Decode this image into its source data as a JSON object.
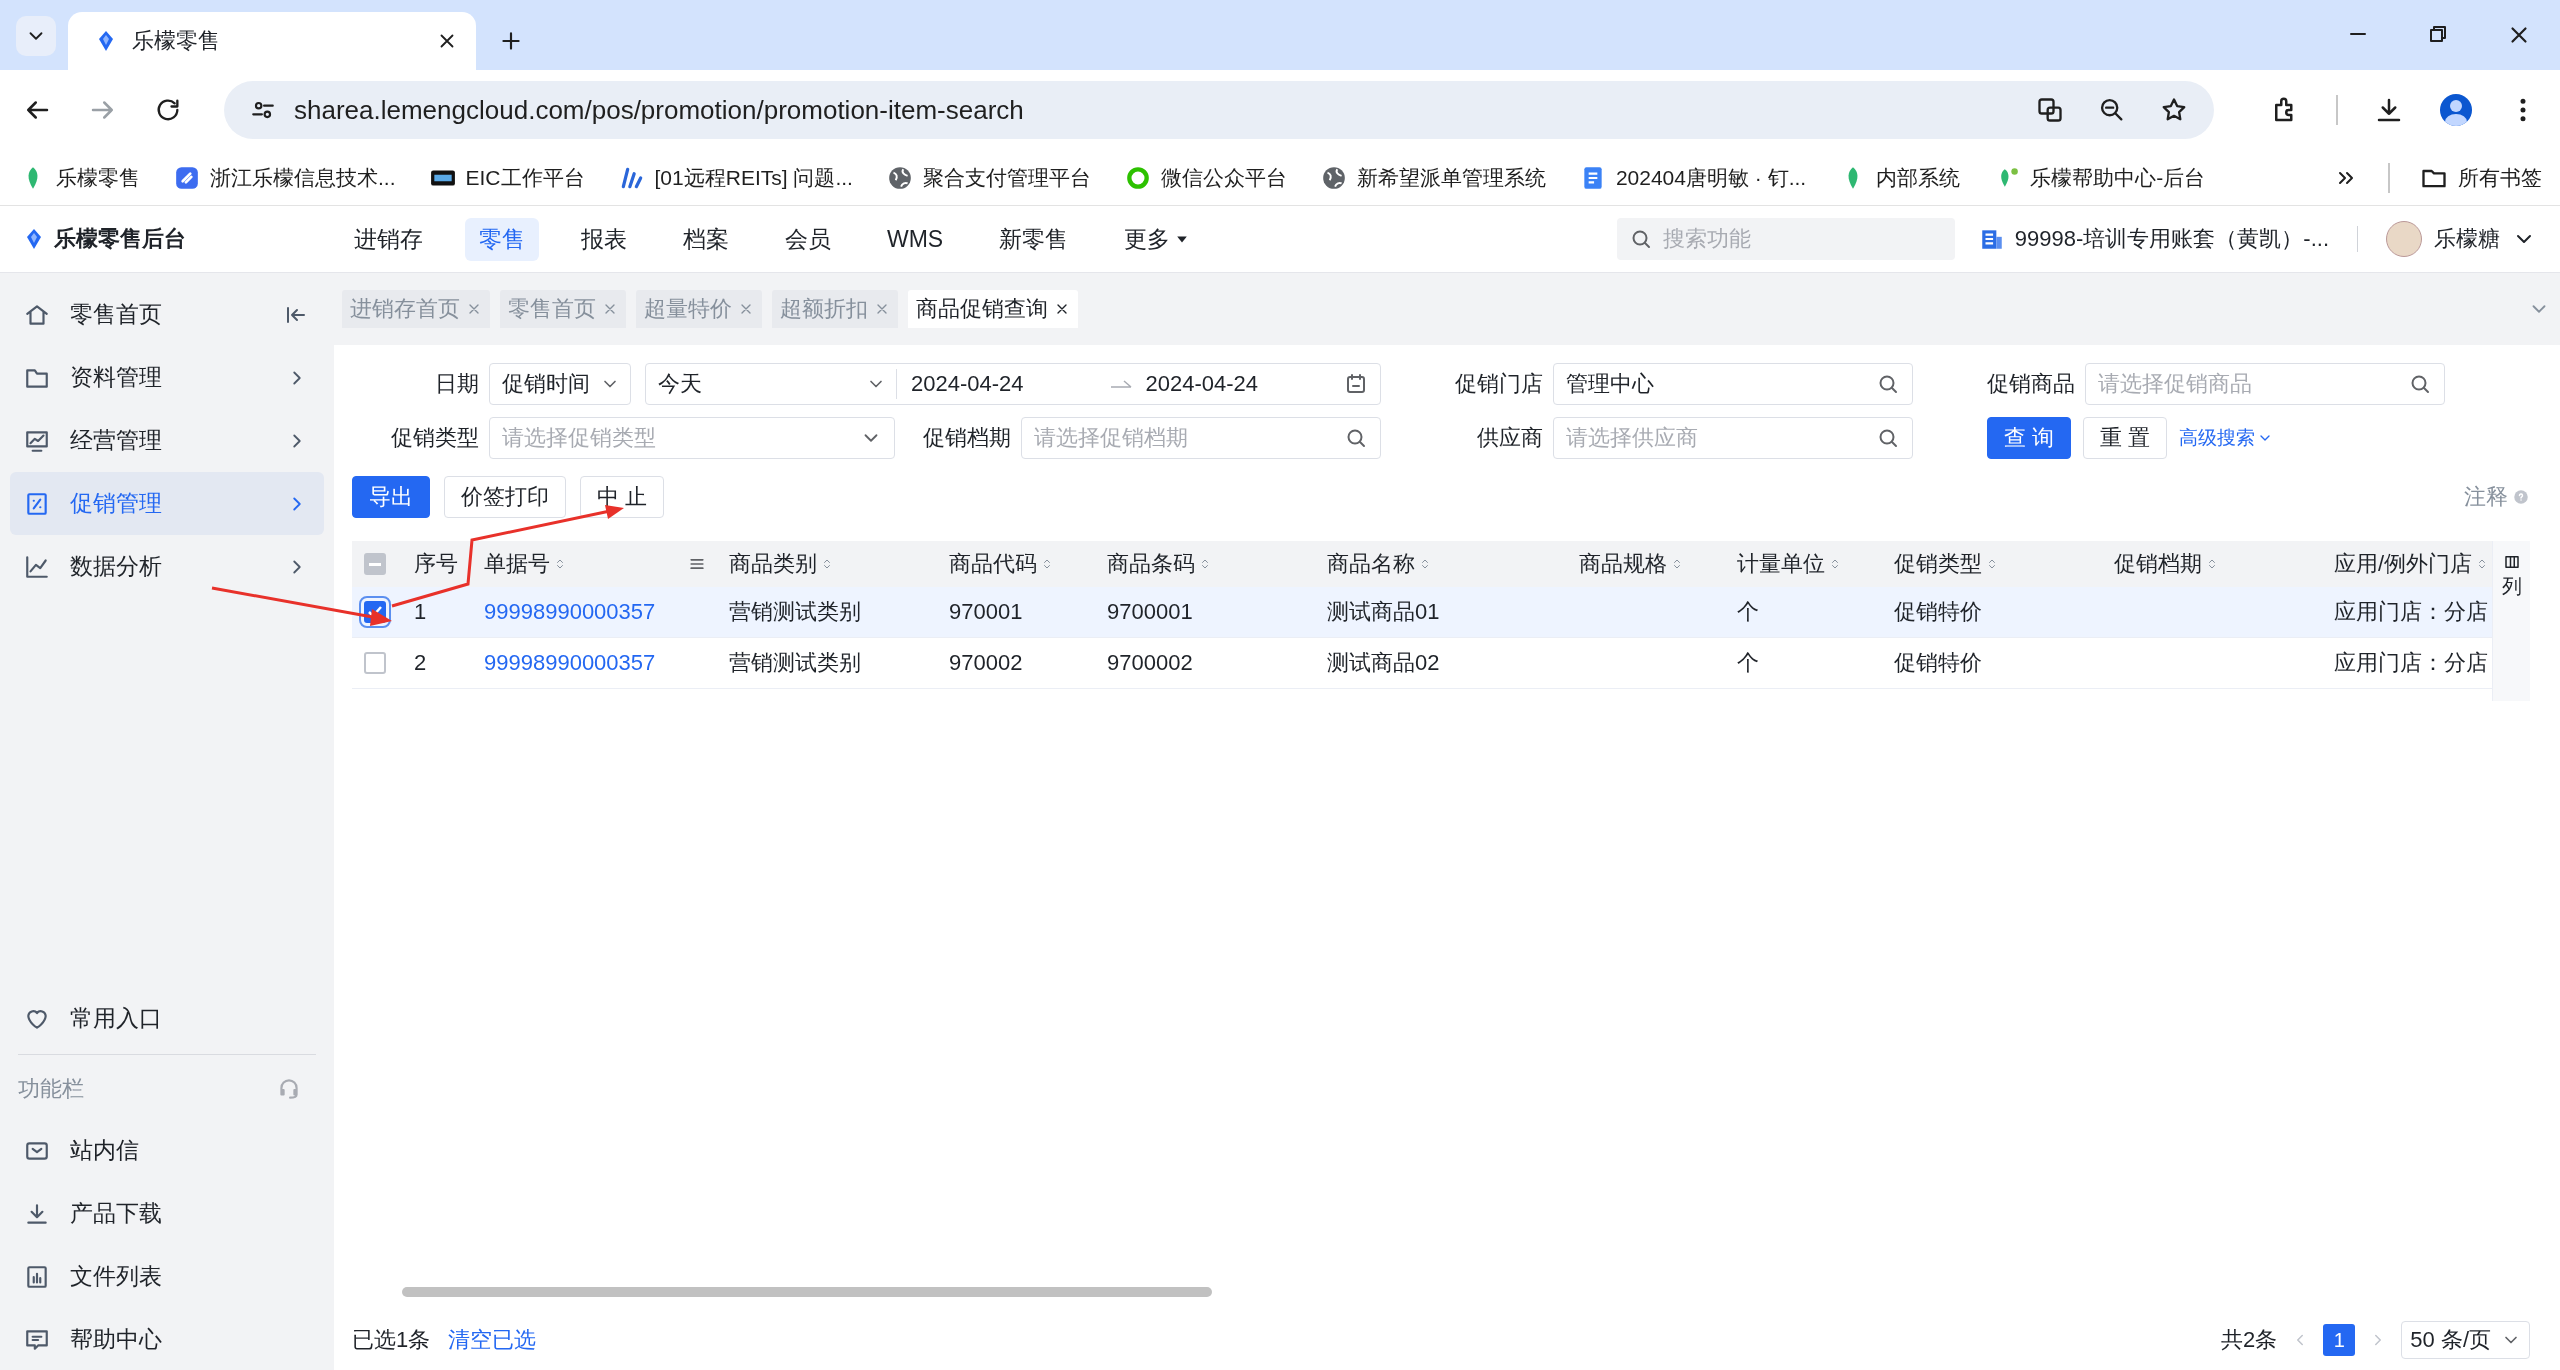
{
  "browser": {
    "tabs": [
      {
        "title": "乐檬零售",
        "selected": true
      }
    ],
    "url": "sharea.lemengcloud.com/pos/promotion/promotion-item-search",
    "bookmarks": [
      "乐檬零售",
      "浙江乐檬信息技术...",
      "EIC工作平台",
      "[01远程REITs] 问题...",
      "聚合支付管理平台",
      "微信公众平台",
      "新希望派单管理系统",
      "202404唐明敏 · 钉...",
      "内部系统",
      "乐檬帮助中心-后台"
    ],
    "bookmark_folder": "所有书签"
  },
  "header": {
    "logo": "乐檬零售后台",
    "nav": [
      {
        "label": "进销存",
        "selected": false
      },
      {
        "label": "零售",
        "selected": true
      },
      {
        "label": "报表",
        "selected": false
      },
      {
        "label": "档案",
        "selected": false
      },
      {
        "label": "会员",
        "selected": false
      },
      {
        "label": "WMS",
        "selected": false
      },
      {
        "label": "新零售",
        "selected": false
      },
      {
        "label": "更多",
        "selected": false,
        "dropdown": true
      }
    ],
    "search": {
      "placeholder": "搜索功能"
    },
    "account": "99998-培训专用账套（黄凯）-...",
    "user": "乐檬糖"
  },
  "sidebar": {
    "items": [
      {
        "label": "零售首页",
        "selected": false,
        "expandable": false
      },
      {
        "label": "资料管理",
        "selected": false,
        "expandable": true
      },
      {
        "label": "经营管理",
        "selected": false,
        "expandable": true
      },
      {
        "label": "促销管理",
        "selected": true,
        "expandable": true
      },
      {
        "label": "数据分析",
        "selected": false,
        "expandable": true
      }
    ],
    "favorites": "常用入口",
    "tools_title": "功能栏",
    "tools": [
      "站内信",
      "产品下载",
      "文件列表",
      "帮助中心"
    ]
  },
  "page_tabs": [
    {
      "label": "进销存首页",
      "selected": false
    },
    {
      "label": "零售首页",
      "selected": false
    },
    {
      "label": "超量特价",
      "selected": false
    },
    {
      "label": "超额折扣",
      "selected": false
    },
    {
      "label": "商品促销查询",
      "selected": true
    }
  ],
  "filters": [
    {
      "label": "日期",
      "kind": "date",
      "mode": "促销时间",
      "preset": "今天",
      "start": "2024-04-24",
      "end": "2024-04-24"
    },
    {
      "label": "促销门店",
      "kind": "search",
      "value": "管理中心"
    },
    {
      "label": "促销商品",
      "kind": "search",
      "placeholder": "请选择促销商品"
    },
    {
      "label": "促销类型",
      "kind": "select",
      "placeholder": "请选择促销类型"
    },
    {
      "label": "促销档期",
      "kind": "search",
      "placeholder": "请选择促销档期"
    },
    {
      "label": "供应商",
      "kind": "search",
      "placeholder": "请选择供应商"
    }
  ],
  "filter_actions": {
    "query": "查 询",
    "reset": "重 置",
    "advanced": "高级搜索"
  },
  "toolbar": {
    "buttons": [
      {
        "label": "导出",
        "primary": true
      },
      {
        "label": "价签打印",
        "primary": false
      },
      {
        "label": "中 止",
        "primary": false
      }
    ],
    "note": "注释"
  },
  "table": {
    "select_all_partial": true,
    "column_settings": "列",
    "columns": [
      {
        "label": "序号",
        "sortable": false
      },
      {
        "label": "单据号",
        "sortable": true
      },
      {
        "label": "商品类别",
        "sortable": true
      },
      {
        "label": "商品代码",
        "sortable": true
      },
      {
        "label": "商品条码",
        "sortable": true
      },
      {
        "label": "商品名称",
        "sortable": true
      },
      {
        "label": "商品规格",
        "sortable": true
      },
      {
        "label": "计量单位",
        "sortable": true
      },
      {
        "label": "促销类型",
        "sortable": true
      },
      {
        "label": "促销档期",
        "sortable": true
      },
      {
        "label": "应用/例外门店",
        "sortable": true
      }
    ],
    "rows": [
      {
        "checked": true,
        "cells": [
          "1",
          "99998990000357",
          "营销测试类别",
          "970001",
          "9700001",
          "测试商品01",
          "",
          "个",
          "促销特价",
          "",
          "应用门店：分店"
        ]
      },
      {
        "checked": false,
        "cells": [
          "2",
          "99998990000357",
          "营销测试类别",
          "970002",
          "9700002",
          "测试商品02",
          "",
          "个",
          "促销特价",
          "",
          "应用门店：分店"
        ]
      }
    ]
  },
  "footer": {
    "selected_text": "已选1条",
    "clear": "清空已选",
    "total": "共2条",
    "pages": [
      {
        "label": "1",
        "selected": true
      }
    ],
    "page_size": "50 条/页"
  },
  "annotations": [
    {
      "kind": "arrow"
    },
    {
      "kind": "arrow"
    }
  ]
}
